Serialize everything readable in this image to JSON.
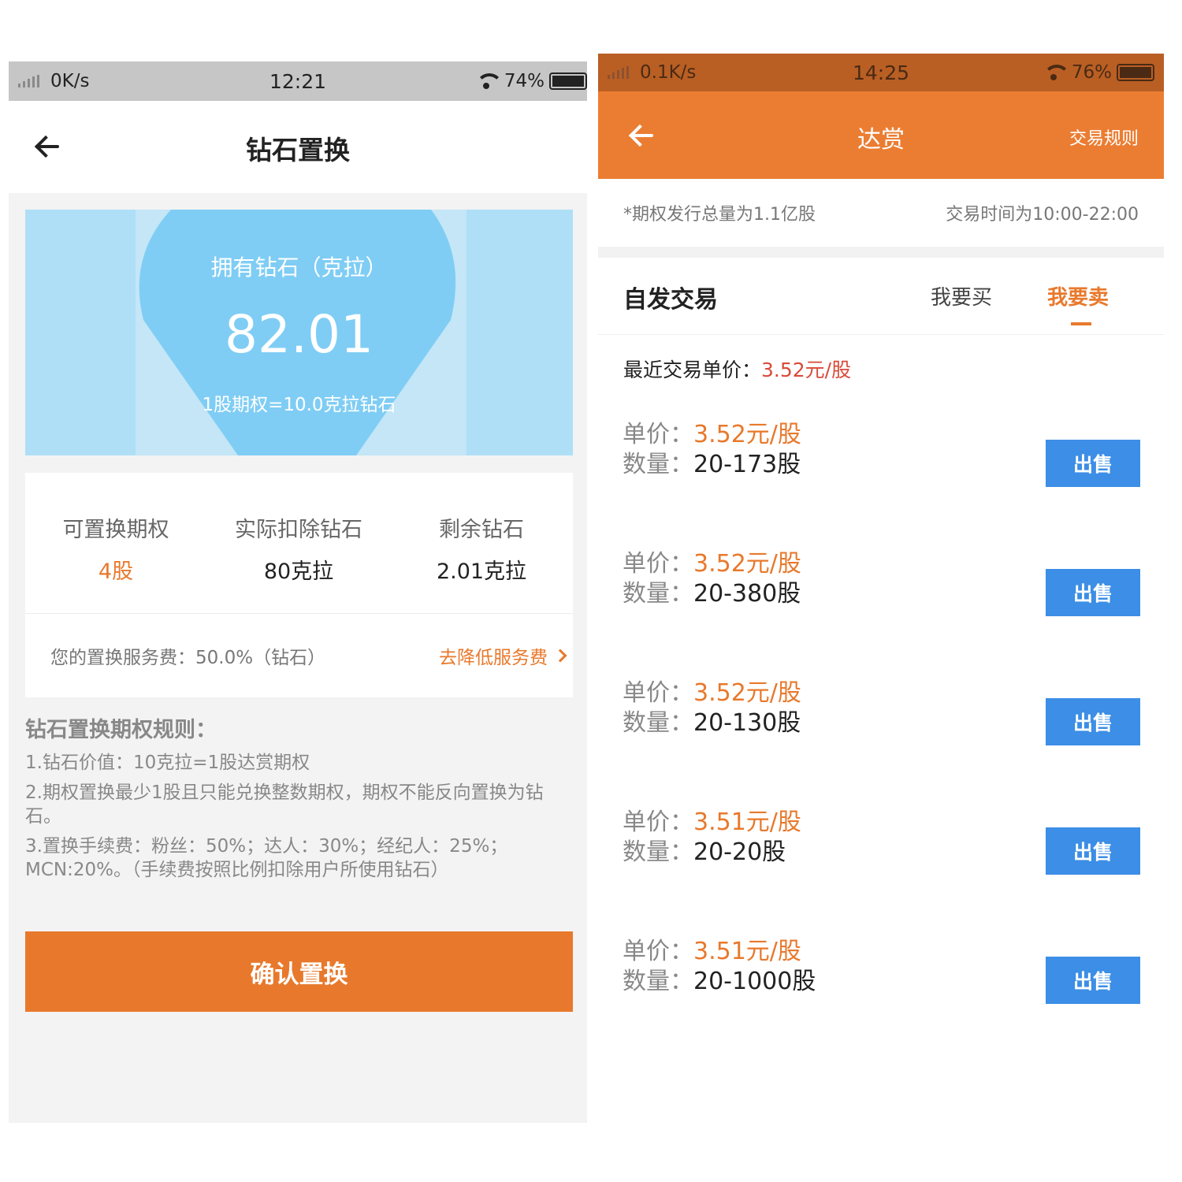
{
  "left": {
    "status_bar": {
      "speed": "0K/s",
      "time": "12:21",
      "battery": "74%"
    },
    "header": {
      "title": "钻石置换"
    },
    "diamond": {
      "label": "拥有钻石（克拉）",
      "amount": "82.01",
      "rate": "1股期权=10.0克拉钻石"
    },
    "stats": [
      {
        "label": "可置换期权",
        "value": "4股"
      },
      {
        "label": "实际扣除钻石",
        "value": "80克拉"
      },
      {
        "label": "剩余钻石",
        "value": "2.01克拉"
      }
    ],
    "fee": {
      "text": "您的置换服务费：50.0%（钻石）",
      "link": "去降低服务费"
    },
    "rules": {
      "title": "钻石置换期权规则：",
      "items": [
        "1.钻石价值：10克拉=1股达赏期权",
        "2.期权置换最少1股且只能兑换整数期权，期权不能反向置换为钻石。",
        "3.置换手续费：粉丝：50%；达人：30%；经纪人：25%；MCN:20%。（手续费按照比例扣除用户所使用钻石）"
      ]
    },
    "confirm_label": "确认置换"
  },
  "right": {
    "status_bar": {
      "speed": "0.1K/s",
      "time": "14:25",
      "battery": "76%"
    },
    "header": {
      "title": "达赏",
      "rules_link": "交易规则"
    },
    "notice": {
      "left": "*期权发行总量为1.1亿股",
      "right": "交易时间为10:00-22:00"
    },
    "tabs": {
      "title": "自发交易",
      "buy": "我要买",
      "sell": "我要卖"
    },
    "recent": {
      "label": "最近交易单价：",
      "price": "3.52元/股"
    },
    "order_labels": {
      "price": "单价：",
      "qty": "数量："
    },
    "orders": [
      {
        "price": "3.52元/股",
        "qty": "20-173股",
        "action": "出售"
      },
      {
        "price": "3.52元/股",
        "qty": "20-380股",
        "action": "出售"
      },
      {
        "price": "3.52元/股",
        "qty": "20-130股",
        "action": "出售"
      },
      {
        "price": "3.51元/股",
        "qty": "20-20股",
        "action": "出售"
      },
      {
        "price": "3.51元/股",
        "qty": "20-1000股",
        "action": "出售"
      }
    ]
  },
  "colors": {
    "accent_orange": "#e8792c",
    "sell_blue": "#3c8ee6",
    "price_red": "#d94b3a",
    "diamond_blue": "#8fd3f6"
  },
  "icons": [
    "signal-icon",
    "wifi-icon",
    "battery-icon",
    "back-arrow-icon",
    "chevron-right-icon",
    "diamond-shape-icon"
  ]
}
